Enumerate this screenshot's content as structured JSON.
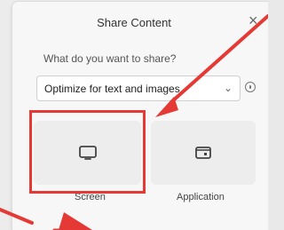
{
  "dialog": {
    "title": "Share Content",
    "close_label": "×",
    "question": "What do you want to share?",
    "select": {
      "value": "Optimize for text and images",
      "chevron": "⌄"
    },
    "info_icon": "info-icon",
    "options": [
      {
        "label": "Screen",
        "icon": "monitor-icon"
      },
      {
        "label": "Application",
        "icon": "window-icon"
      }
    ]
  },
  "annotation": {
    "color": "#e53935"
  }
}
